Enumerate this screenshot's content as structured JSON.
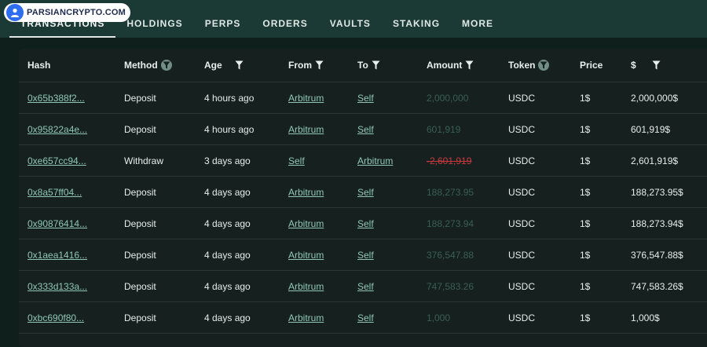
{
  "watermark": {
    "text": "PARSIANCRYPTO.COM"
  },
  "tabs": [
    {
      "label": "TRANSACTIONS",
      "active": true
    },
    {
      "label": "HOLDINGS"
    },
    {
      "label": "PERPS"
    },
    {
      "label": "ORDERS"
    },
    {
      "label": "VAULTS"
    },
    {
      "label": "STAKING"
    },
    {
      "label": "MORE"
    }
  ],
  "table": {
    "headers": {
      "hash": "Hash",
      "method": "Method",
      "age": "Age",
      "from": "From",
      "to": "To",
      "amount": "Amount",
      "token": "Token",
      "price": "Price",
      "usd": "$"
    },
    "rows": [
      {
        "hash": "0x65b388f2...",
        "method": "Deposit",
        "age": "4 hours ago",
        "from": "Arbitrum",
        "to": "Self",
        "amount": "2,000,000",
        "token": "USDC",
        "price": "1$",
        "usd": "2,000,000$"
      },
      {
        "hash": "0x95822a4e...",
        "method": "Deposit",
        "age": "4 hours ago",
        "from": "Arbitrum",
        "to": "Self",
        "amount": "601,919",
        "token": "USDC",
        "price": "1$",
        "usd": "601,919$"
      },
      {
        "hash": "0xe657cc94...",
        "method": "Withdraw",
        "age": "3 days ago",
        "from": "Self",
        "to": "Arbitrum",
        "amount": "-2,601,919",
        "token": "USDC",
        "price": "1$",
        "usd": "2,601,919$"
      },
      {
        "hash": "0x8a57ff04...",
        "method": "Deposit",
        "age": "4 days ago",
        "from": "Arbitrum",
        "to": "Self",
        "amount": "188,273.95",
        "token": "USDC",
        "price": "1$",
        "usd": "188,273.95$"
      },
      {
        "hash": "0x90876414...",
        "method": "Deposit",
        "age": "4 days ago",
        "from": "Arbitrum",
        "to": "Self",
        "amount": "188,273.94",
        "token": "USDC",
        "price": "1$",
        "usd": "188,273.94$"
      },
      {
        "hash": "0x1aea1416...",
        "method": "Deposit",
        "age": "4 days ago",
        "from": "Arbitrum",
        "to": "Self",
        "amount": "376,547.88",
        "token": "USDC",
        "price": "1$",
        "usd": "376,547.88$"
      },
      {
        "hash": "0x333d133a...",
        "method": "Deposit",
        "age": "4 days ago",
        "from": "Arbitrum",
        "to": "Self",
        "amount": "747,583.26",
        "token": "USDC",
        "price": "1$",
        "usd": "747,583.26$"
      },
      {
        "hash": "0xbc690f80...",
        "method": "Deposit",
        "age": "4 days ago",
        "from": "Arbitrum",
        "to": "Self",
        "amount": "1,000",
        "token": "USDC",
        "price": "1$",
        "usd": "1,000$"
      }
    ]
  },
  "colors": {
    "link": "#8fc6b8",
    "amount_positive": "#3a5d54",
    "amount_negative": "#c8383e",
    "topbar": "#1c3a35",
    "panel": "#16211f"
  },
  "icons": {
    "filter": "funnel-filter-icon",
    "watermark": "user-badge-icon"
  }
}
